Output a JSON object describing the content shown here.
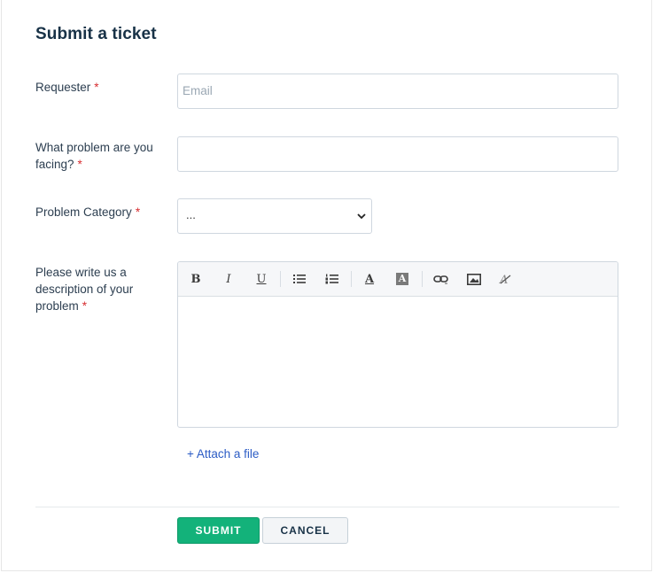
{
  "form": {
    "title": "Submit a ticket",
    "required_mark": "*",
    "requester": {
      "label": "Requester",
      "placeholder": "Email"
    },
    "problem": {
      "label": "What problem are you facing?"
    },
    "category": {
      "label": "Problem Category",
      "value": "..."
    },
    "description": {
      "label": "Please write us a description of your problem",
      "toolbar": [
        {
          "name": "bold-icon",
          "glyph": "B"
        },
        {
          "name": "italic-icon",
          "glyph": "I"
        },
        {
          "name": "underline-icon",
          "glyph": "U"
        },
        {
          "name": "bullet-list-icon"
        },
        {
          "name": "numbered-list-icon"
        },
        {
          "name": "font-color-icon",
          "glyph": "A"
        },
        {
          "name": "background-color-icon",
          "glyph": "A"
        },
        {
          "name": "link-icon"
        },
        {
          "name": "image-icon"
        },
        {
          "name": "clear-format-icon"
        }
      ]
    },
    "attach_label": "+ Attach a file",
    "submit_label": "SUBMIT",
    "cancel_label": "CANCEL"
  },
  "colors": {
    "submit_bg": "#13b27a",
    "required": "#d72d30",
    "link": "#2c5cc5",
    "title": "#183247"
  }
}
